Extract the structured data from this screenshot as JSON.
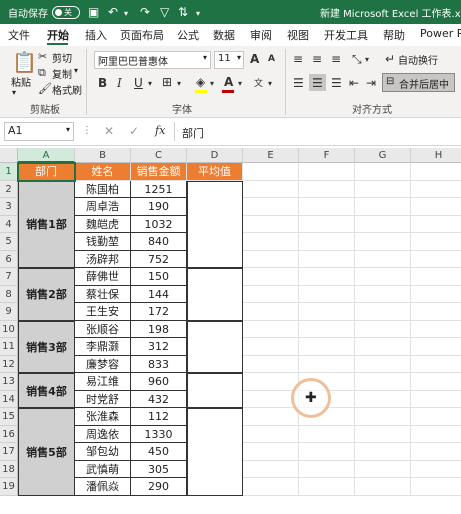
{
  "titlebar": {
    "autosave_label": "自动保存",
    "autosave_state": "关",
    "doc_title": "新建 Microsoft Excel 工作表.xlsx"
  },
  "tabs": [
    "文件",
    "开始",
    "插入",
    "页面布局",
    "公式",
    "数据",
    "审阅",
    "视图",
    "开发工具",
    "帮助",
    "Power Pi"
  ],
  "ribbon": {
    "paste_label": "粘贴",
    "cut_label": "剪切",
    "copy_label": "复制",
    "format_painter_label": "格式刷",
    "clipboard_group": "剪贴板",
    "font_name": "阿里巴巴普惠体",
    "font_size": "11",
    "font_group": "字体",
    "wrap_text_label": "自动换行",
    "merge_center_label": "合并后居中",
    "alignment_group": "对齐方式",
    "bold": "B",
    "italic": "I",
    "underline": "U",
    "grow_font": "A",
    "shrink_font": "A",
    "font_color_letter": "A",
    "highlight_color": "#ffff00",
    "font_color": "#c00000"
  },
  "formulabar": {
    "name_box": "A1",
    "formula": "部门",
    "fx": "fx",
    "cancel": "✕",
    "enter": "✓"
  },
  "columns": [
    "A",
    "B",
    "C",
    "D",
    "E",
    "F",
    "G",
    "H"
  ],
  "rows": [
    "1",
    "2",
    "3",
    "4",
    "5",
    "6",
    "7",
    "8",
    "9",
    "10",
    "11",
    "12",
    "13",
    "14",
    "15",
    "16",
    "17",
    "18",
    "19"
  ],
  "headers": {
    "a": "部门",
    "b": "姓名",
    "c": "销售金额",
    "d": "平均值"
  },
  "departments": [
    {
      "name": "销售1部"
    },
    {
      "name": "销售2部"
    },
    {
      "name": "销售3部"
    },
    {
      "name": "销售4部"
    },
    {
      "name": "销售5部"
    }
  ],
  "records": [
    {
      "name": "陈国柏",
      "amount": "1251"
    },
    {
      "name": "周卓浩",
      "amount": "190"
    },
    {
      "name": "魏皑虎",
      "amount": "1032"
    },
    {
      "name": "钱勤堃",
      "amount": "840"
    },
    {
      "name": "汤辟邦",
      "amount": "752"
    },
    {
      "name": "薛佛世",
      "amount": "150"
    },
    {
      "name": "蔡壮保",
      "amount": "144"
    },
    {
      "name": "王生安",
      "amount": "172"
    },
    {
      "name": "张顺谷",
      "amount": "198"
    },
    {
      "name": "李鼎灏",
      "amount": "312"
    },
    {
      "name": "廉梦容",
      "amount": "833"
    },
    {
      "name": "易江维",
      "amount": "960"
    },
    {
      "name": "时党舒",
      "amount": "432"
    },
    {
      "name": "张淮森",
      "amount": "112"
    },
    {
      "name": "周逸依",
      "amount": "1330"
    },
    {
      "name": "邹包幼",
      "amount": "450"
    },
    {
      "name": "武慎萌",
      "amount": "305"
    },
    {
      "name": "潘佩焱",
      "amount": "290"
    }
  ],
  "colors": {
    "excel_green": "#1f7244",
    "header_orange": "#ed7d31",
    "dept_gray": "#d0d0d0",
    "cursor_ring": "#efbf9a"
  }
}
